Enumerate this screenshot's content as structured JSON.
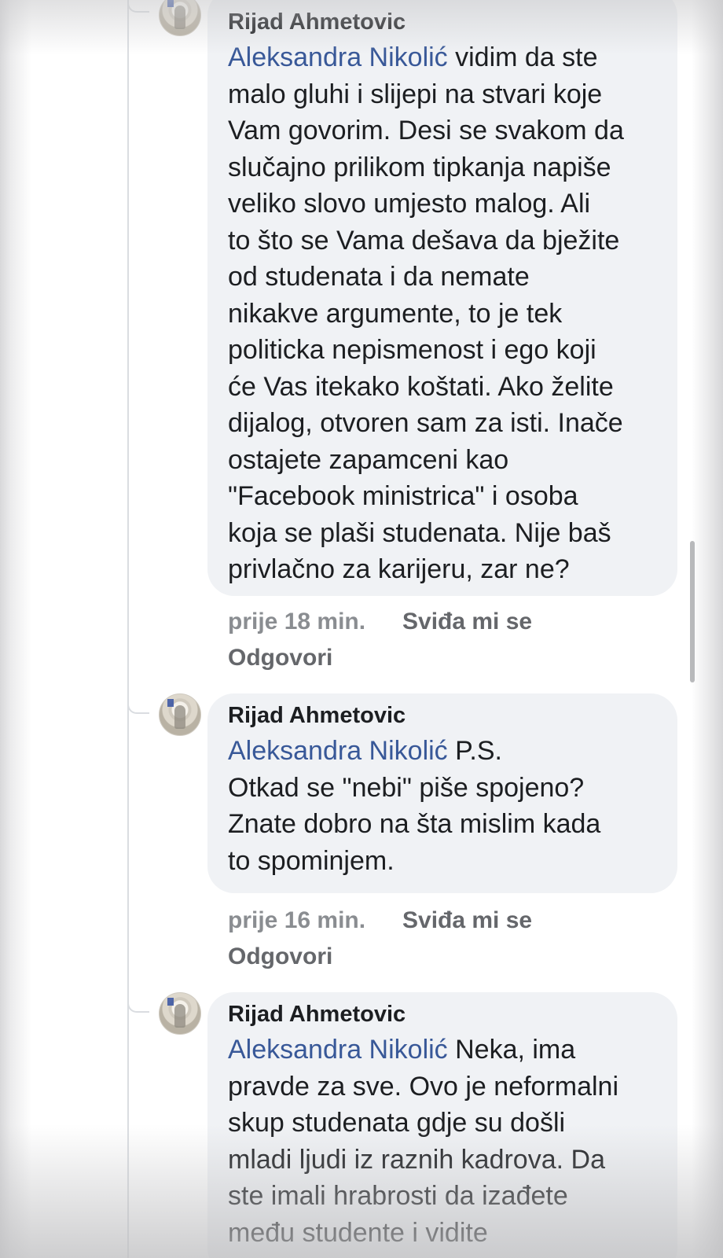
{
  "comments": [
    {
      "author": "Rijad Ahmetovic",
      "mention": "Aleksandra Nikolić",
      "text": " vidim da ste\nmalo gluhi i slijepi na stvari koje\nVam govorim. Desi se svakom da\nslučajno prilikom tipkanja napiše\nveliko slovo umjesto malog. Ali\nto što se Vama dešava da bježite\nod studenata i da nemate\nnikakve argumente, to je tek\npoliticka nepismenost i ego koji\nće Vas itekako koštati. Ako želite\ndijalog, otvoren sam za isti. Inače\nostajete zapamceni kao\n\"Facebook ministrica\" i osoba\nkoja se plaši studenata. Nije baš\nprivlačno za karijeru, zar ne?",
      "time": "prije 18 min.",
      "like": "Sviđa mi se",
      "reply": "Odgovori"
    },
    {
      "author": "Rijad Ahmetovic",
      "mention": "Aleksandra Nikolić",
      "text": " P.S.\nOtkad se \"nebi\" piše spojeno?\nZnate dobro na šta mislim kada\nto spominjem.",
      "time": "prije 16 min.",
      "like": "Sviđa mi se",
      "reply": "Odgovori"
    },
    {
      "author": "Rijad Ahmetovic",
      "mention": "Aleksandra Nikolić",
      "text": " Neka, ima\npravde za sve. Ovo je neformalni\nskup studenata gdje su došli\nmladi ljudi iz raznih kadrova. Da\nste imali hrabrosti da izađete\nmeđu studente i vidite"
    }
  ]
}
